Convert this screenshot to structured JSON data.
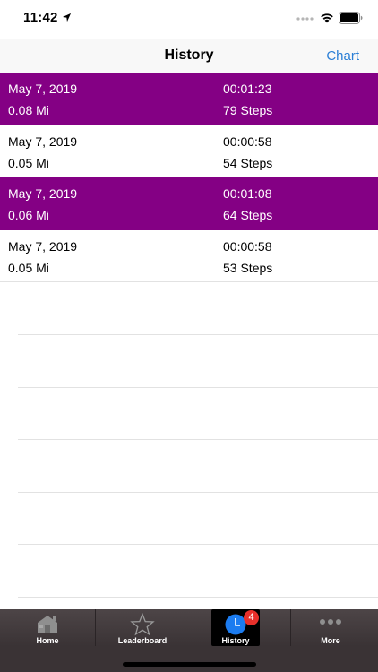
{
  "status_bar": {
    "time": "11:42"
  },
  "nav": {
    "title": "History",
    "action_label": "Chart",
    "action_color": "#2b7fd6"
  },
  "history": {
    "highlight_color": "#840084",
    "rows": [
      {
        "date": "May 7, 2019",
        "distance": "0.08 Mi",
        "duration": "00:01:23",
        "steps": "79 Steps",
        "highlighted": true
      },
      {
        "date": "May 7, 2019",
        "distance": "0.05 Mi",
        "duration": "00:00:58",
        "steps": "54 Steps",
        "highlighted": false
      },
      {
        "date": "May 7, 2019",
        "distance": "0.06 Mi",
        "duration": "00:01:08",
        "steps": "64 Steps",
        "highlighted": true
      },
      {
        "date": "May 7, 2019",
        "distance": "0.05 Mi",
        "duration": "00:00:58",
        "steps": "53 Steps",
        "highlighted": false
      }
    ]
  },
  "tab_bar": {
    "tabs": [
      {
        "label": "Home",
        "icon": "house-icon",
        "selected": false
      },
      {
        "label": "Leaderboard",
        "icon": "star-icon",
        "selected": false
      },
      {
        "label": "History",
        "icon": "clock-icon",
        "selected": true,
        "badge": "4"
      },
      {
        "label": "More",
        "icon": "ellipsis-icon",
        "selected": false
      }
    ]
  }
}
